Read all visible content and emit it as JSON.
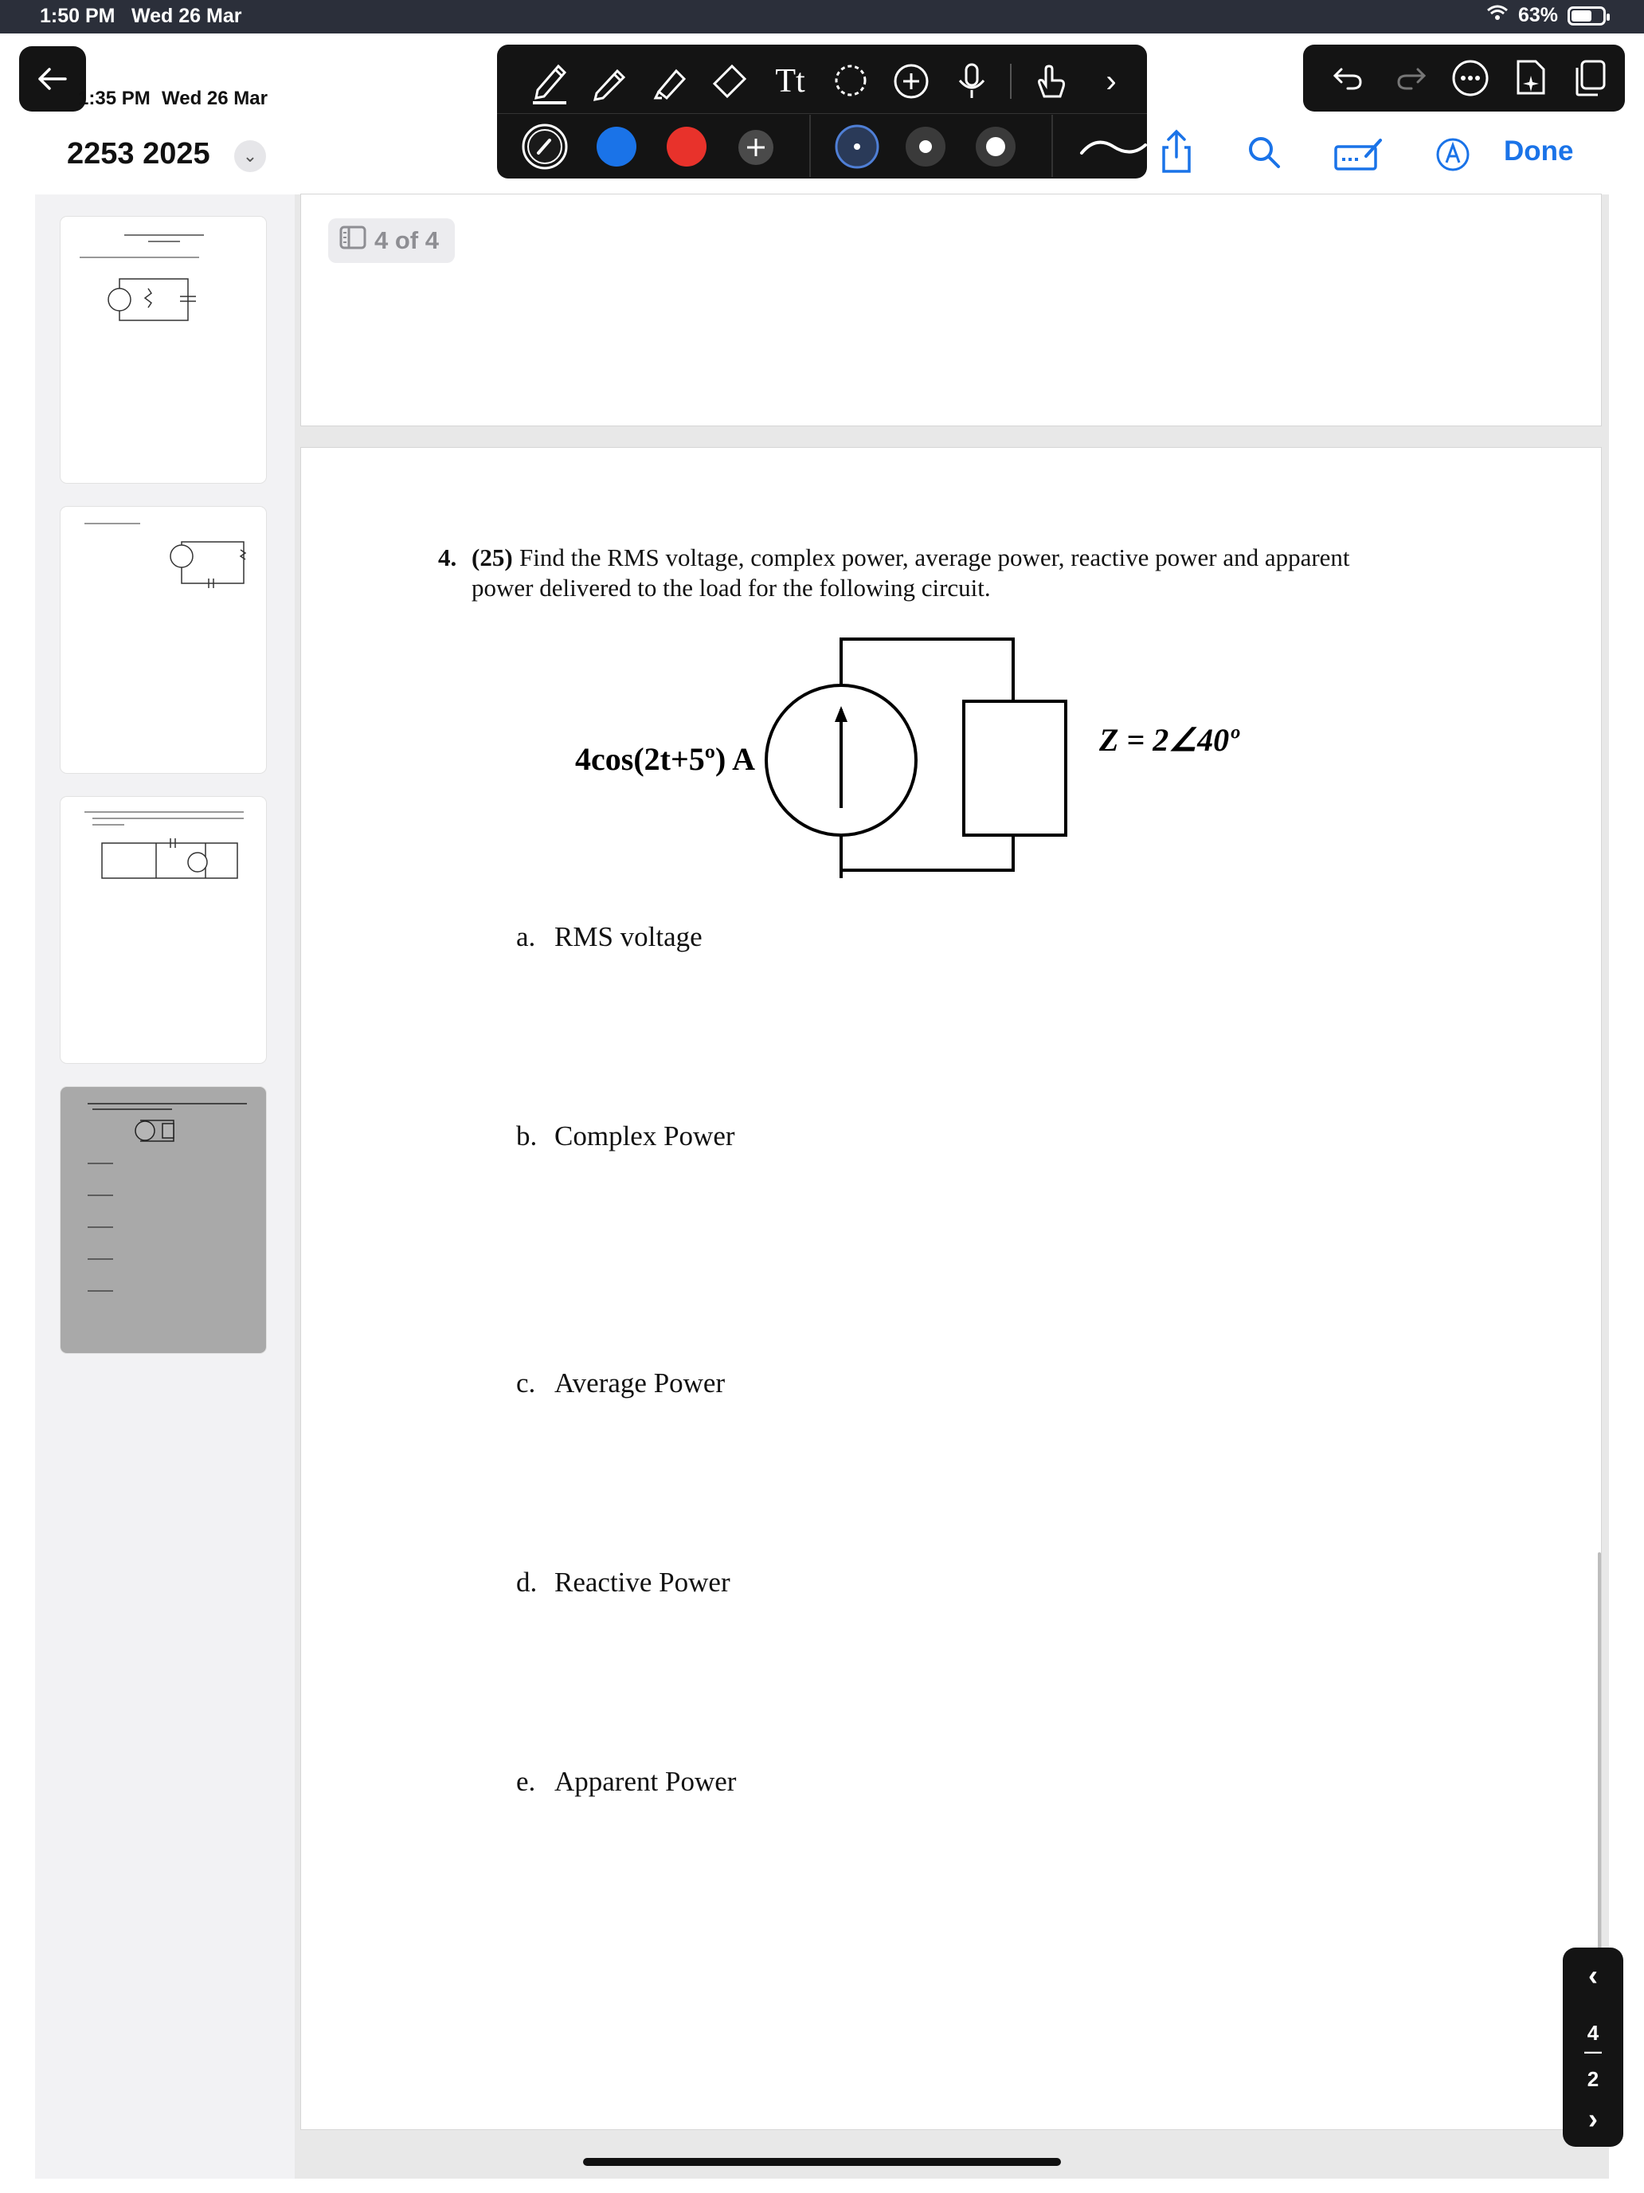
{
  "status_bar": {
    "time": "1:50 PM",
    "date": "Wed 26 Mar",
    "battery": "63%"
  },
  "document": {
    "time": "1:35 PM",
    "date": "Wed 26 Mar",
    "title": "2253 2025"
  },
  "toolbar": {
    "tools": [
      "pen-tool",
      "pencil-tool",
      "highlighter-tool",
      "eraser-tool",
      "text-tool",
      "lasso-tool",
      "add-tool",
      "microphone-tool",
      "touch-draw-tool",
      "more-tools"
    ],
    "colors": [
      "#1a73e8",
      "#e8322b"
    ],
    "active_color": "#1a1a1a",
    "stroke_sizes": [
      "small",
      "medium",
      "large"
    ]
  },
  "header_actions": {
    "done_label": "Done"
  },
  "page_indicator": "4 of 4",
  "question": {
    "number": "4.",
    "points": "(25)",
    "line1": "Find the RMS voltage, complex power, average power, reactive power and apparent",
    "line2": "power delivered to the load for the following circuit.",
    "source_label": "4cos(2t+5º) A",
    "impedance_label": "Z = 2∠40º",
    "parts": [
      {
        "letter": "a.",
        "text": "RMS voltage"
      },
      {
        "letter": "b.",
        "text": "Complex Power"
      },
      {
        "letter": "c.",
        "text": "Average Power"
      },
      {
        "letter": "d.",
        "text": "Reactive Power"
      },
      {
        "letter": "e.",
        "text": "Apparent Power"
      }
    ]
  },
  "page_nav": {
    "current": "4",
    "total": "2"
  }
}
